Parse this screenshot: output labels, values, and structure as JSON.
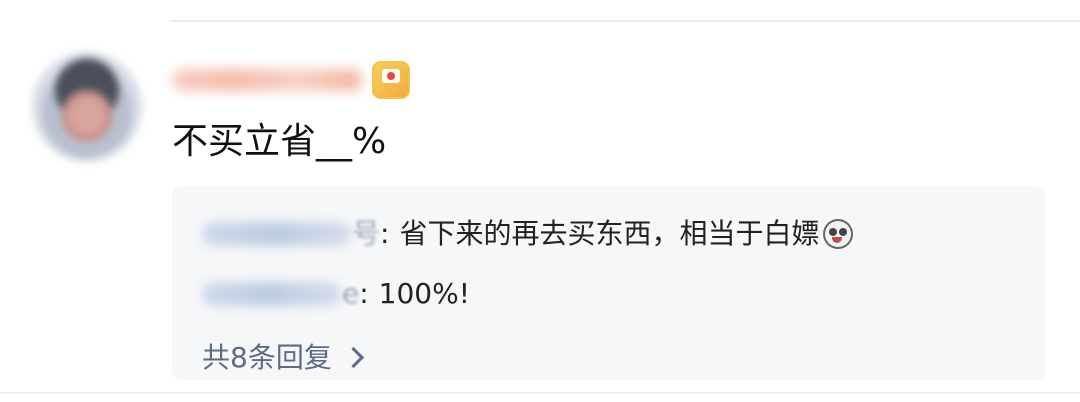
{
  "comment": {
    "text": "不买立省__%"
  },
  "replies": [
    {
      "user_suffix": "号",
      "separator": ":",
      "text": "省下来的再去买东西，相当于白嫖",
      "emoji": "shock-face-icon"
    },
    {
      "user_suffix": "e",
      "separator": ":",
      "text": "100%!"
    }
  ],
  "view_more": {
    "label": "共8条回复"
  },
  "icons": {
    "badge": "vip-badge-icon",
    "chevron": "chevron-right-icon"
  },
  "colors": {
    "reply_background": "#f6f7f9",
    "link": "#5f6b85"
  }
}
